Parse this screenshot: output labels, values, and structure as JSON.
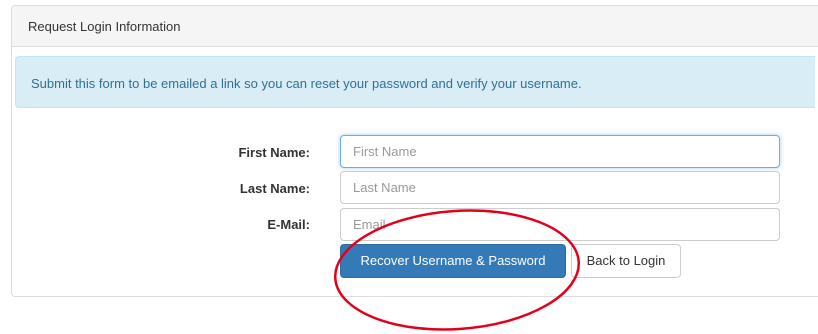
{
  "panel": {
    "title": "Request Login Information"
  },
  "alert": {
    "message": "Submit this form to be emailed a link so you can reset your password and verify your username."
  },
  "form": {
    "first_name": {
      "label": "First Name:",
      "placeholder": "First Name",
      "value": ""
    },
    "last_name": {
      "label": "Last Name:",
      "placeholder": "Last Name",
      "value": ""
    },
    "email": {
      "label": "E-Mail:",
      "placeholder": "Email",
      "value": ""
    }
  },
  "buttons": {
    "recover_label": "Recover Username & Password",
    "back_label": "Back to Login"
  },
  "colors": {
    "primary": "#337ab7",
    "alert_bg": "#d9edf7",
    "alert_text": "#31708f",
    "annotation": "#e3001b"
  }
}
